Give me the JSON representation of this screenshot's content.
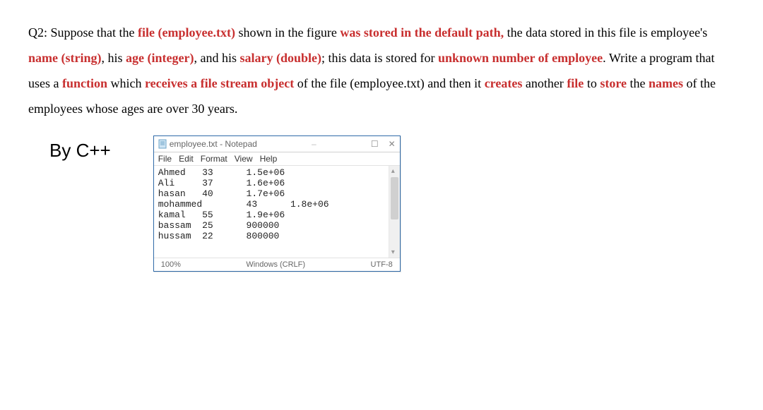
{
  "question": {
    "label": "Q2:",
    "t1": "Suppose that the ",
    "file_phrase": "file (employee.txt)",
    "t2": " shown in the figure ",
    "stored_phrase": "was stored in the default path,",
    "t3": " the data stored in this file is employee's ",
    "name_phrase": "name (string)",
    "t4": ", his ",
    "age_phrase": "age (integer)",
    "t5": ", and his ",
    "salary_phrase": "salary (double)",
    "t6": "; this data is stored for ",
    "unknown_phrase": "unknown number of employee",
    "t7": ". Write a program that uses a ",
    "function_word": "function",
    "t8": " which ",
    "receives_phrase": "receives a file stream object",
    "t9": " of the file (employee.txt) and then it ",
    "creates_word": "creates",
    "t10": " another ",
    "file_word": "file",
    "t11": " to ",
    "store_word": "store",
    "t12": " the ",
    "names_word": "names",
    "t13": " of the employees whose ages are over 30 years."
  },
  "language": "By C++",
  "notepad": {
    "title": "employee.txt - Notepad",
    "window_controls": {
      "dash": "–",
      "max": "☐",
      "close": "✕"
    },
    "menu": [
      "File",
      "Edit",
      "Format",
      "View",
      "Help"
    ],
    "lines": [
      "Ahmed   33      1.5e+06",
      "Ali     37      1.6e+06",
      "hasan   40      1.7e+06",
      "mohammed        43      1.8e+06",
      "kamal   55      1.9e+06",
      "bassam  25      900000",
      "hussam  22      800000"
    ],
    "status": {
      "zoom": "100%",
      "eol": "Windows (CRLF)",
      "encoding": "UTF-8"
    }
  }
}
